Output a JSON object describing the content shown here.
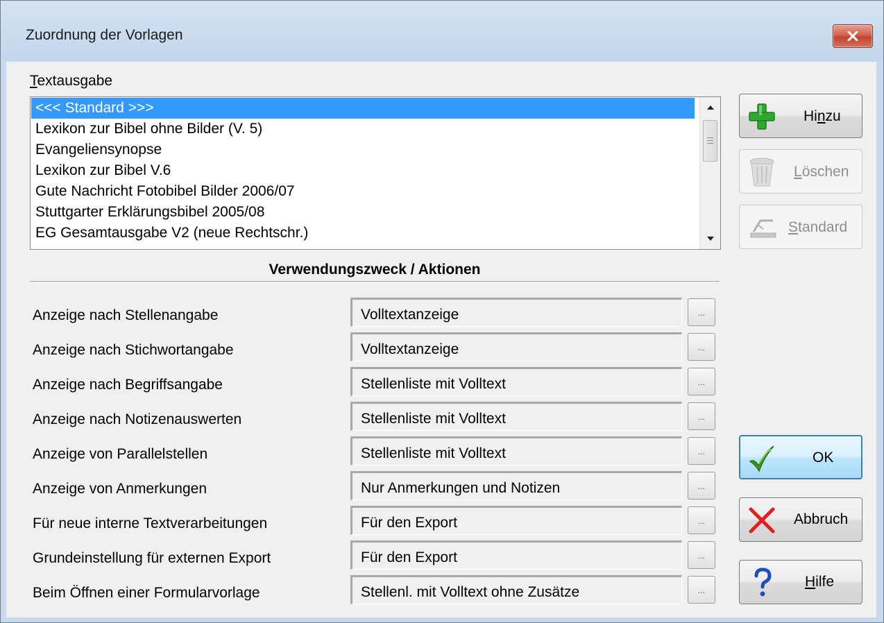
{
  "window": {
    "title": "Zuordnung der Vorlagen",
    "close_label": "✕"
  },
  "textausgabe": {
    "label_first": "T",
    "label_rest": "extausgabe",
    "items": [
      "<<< Standard >>>",
      "Lexikon zur Bibel ohne Bilder (V. 5)",
      "Evangeliensynopse",
      "Lexikon zur Bibel V.6",
      "Gute Nachricht Fotobibel Bilder 2006/07",
      "Stuttgarter Erklärungsbibel 2005/08",
      "EG Gesamtausgabe V2 (neue Rechtschr.)"
    ],
    "selected_index": 0
  },
  "side_buttons": {
    "add": {
      "pre": "Hi",
      "ul": "n",
      "post": "zu"
    },
    "delete": {
      "pre": "",
      "ul": "L",
      "post": "öschen"
    },
    "standard": {
      "pre": "",
      "ul": "S",
      "post": "tandard"
    }
  },
  "section": {
    "heading": "Verwendungszweck / Aktionen"
  },
  "rows": [
    {
      "label": "Anzeige nach Stellenangabe",
      "value": "Volltextanzeige",
      "button": "..."
    },
    {
      "label": "Anzeige nach Stichwortangabe",
      "value": "Volltextanzeige",
      "button": "..."
    },
    {
      "label": "Anzeige nach Begriffsangabe",
      "value": "Stellenliste mit Volltext",
      "button": "..."
    },
    {
      "label": "Anzeige nach Notizenauswerten",
      "value": "Stellenliste mit Volltext",
      "button": "..."
    },
    {
      "label": "Anzeige von Parallelstellen",
      "value": "Stellenliste mit Volltext",
      "button": "..."
    },
    {
      "label": "Anzeige von Anmerkungen",
      "value": "Nur Anmerkungen und Notizen",
      "button": "..."
    },
    {
      "label": "Für neue interne Textverarbeitungen",
      "value": "Für den Export",
      "button": "..."
    },
    {
      "label": "Grundeinstellung für externen Export",
      "value": "Für den Export",
      "button": "..."
    },
    {
      "label": "Beim Öffnen einer Formularvorlage",
      "value": "Stellenl. mit Volltext ohne Zusätze",
      "button": "..."
    }
  ],
  "dialog_buttons": {
    "ok": "OK",
    "cancel": "Abbruch",
    "help_ul": "H",
    "help_rest": "ilfe"
  },
  "colors": {
    "selection": "#3399ff",
    "add_icon": "#2fa82f",
    "cancel_icon": "#e02020",
    "help_icon": "#1f4fb5",
    "ok_icon": "#3f9a1c"
  }
}
